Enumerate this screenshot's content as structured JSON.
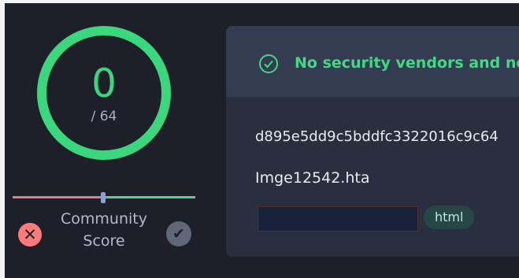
{
  "score": {
    "detections": "0",
    "total": "/ 64",
    "ring_color": "#3bd77e"
  },
  "community": {
    "label_line1": "Community",
    "label_line2": "Score",
    "negative_color": "#e67b7f",
    "positive_color": "#52d394"
  },
  "summary": {
    "status_text": "No security vendors and no",
    "status_color": "#45d882",
    "status_icon": "check-circle-icon"
  },
  "file": {
    "hash": "d895e5dd9c5bddfc3322016c9c64",
    "name": "Imge12542.hta",
    "tag": "html"
  }
}
